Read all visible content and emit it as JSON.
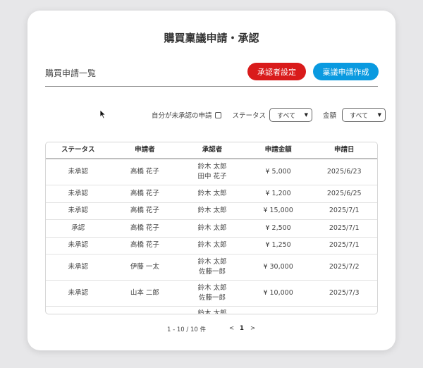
{
  "page": {
    "title": "購買稟議申請・承認"
  },
  "section": {
    "title": "購買申請一覧"
  },
  "buttons": {
    "approver_settings": "承認者設定",
    "create_request": "稟議申請作成"
  },
  "filters": {
    "unapproved_label": "自分が未承認の申請",
    "unapproved_checked": false,
    "status_label": "ステータス",
    "status_value": "すべて",
    "amount_label": "金額",
    "amount_value": "すべて"
  },
  "table": {
    "headers": {
      "status": "ステータス",
      "applicant": "申請者",
      "approver": "承認者",
      "amount": "申請金額",
      "date": "申請日"
    },
    "rows": [
      {
        "status": "未承認",
        "applicant": "高橋 花子",
        "approver1": "鈴木 太郎",
        "approver2": "田中 花子",
        "amount": "¥ 5,000",
        "date": "2025/6/23"
      },
      {
        "status": "未承認",
        "applicant": "高橋 花子",
        "approver1": "鈴木 太郎",
        "approver2": "",
        "amount": "¥ 1,200",
        "date": "2025/6/25"
      },
      {
        "status": "未承認",
        "applicant": "高橋 花子",
        "approver1": "鈴木 太郎",
        "approver2": "",
        "amount": "¥ 15,000",
        "date": "2025/7/1"
      },
      {
        "status": "承認",
        "applicant": "高橋 花子",
        "approver1": "鈴木 太郎",
        "approver2": "",
        "amount": "¥ 2,500",
        "date": "2025/7/1"
      },
      {
        "status": "未承認",
        "applicant": "高橋 花子",
        "approver1": "鈴木 太郎",
        "approver2": "",
        "amount": "¥ 1,250",
        "date": "2025/7/1"
      },
      {
        "status": "未承認",
        "applicant": "伊藤 一太",
        "approver1": "鈴木 太郎",
        "approver2": "佐藤一郎",
        "amount": "¥ 30,000",
        "date": "2025/7/2"
      },
      {
        "status": "未承認",
        "applicant": "山本 二郎",
        "approver1": "鈴木 太郎",
        "approver2": "佐藤一郎",
        "amount": "¥ 10,000",
        "date": "2025/7/3"
      },
      {
        "status": "",
        "applicant": "",
        "approver1": "鈴木 太郎",
        "approver2": "",
        "amount": "",
        "date": ""
      }
    ]
  },
  "pagination": {
    "info": "1 - 10 / 10 件",
    "prev": "<",
    "current": "1",
    "next": ">"
  },
  "colors": {
    "red_button": "#d91b1b",
    "blue_button": "#0a9ae0"
  }
}
